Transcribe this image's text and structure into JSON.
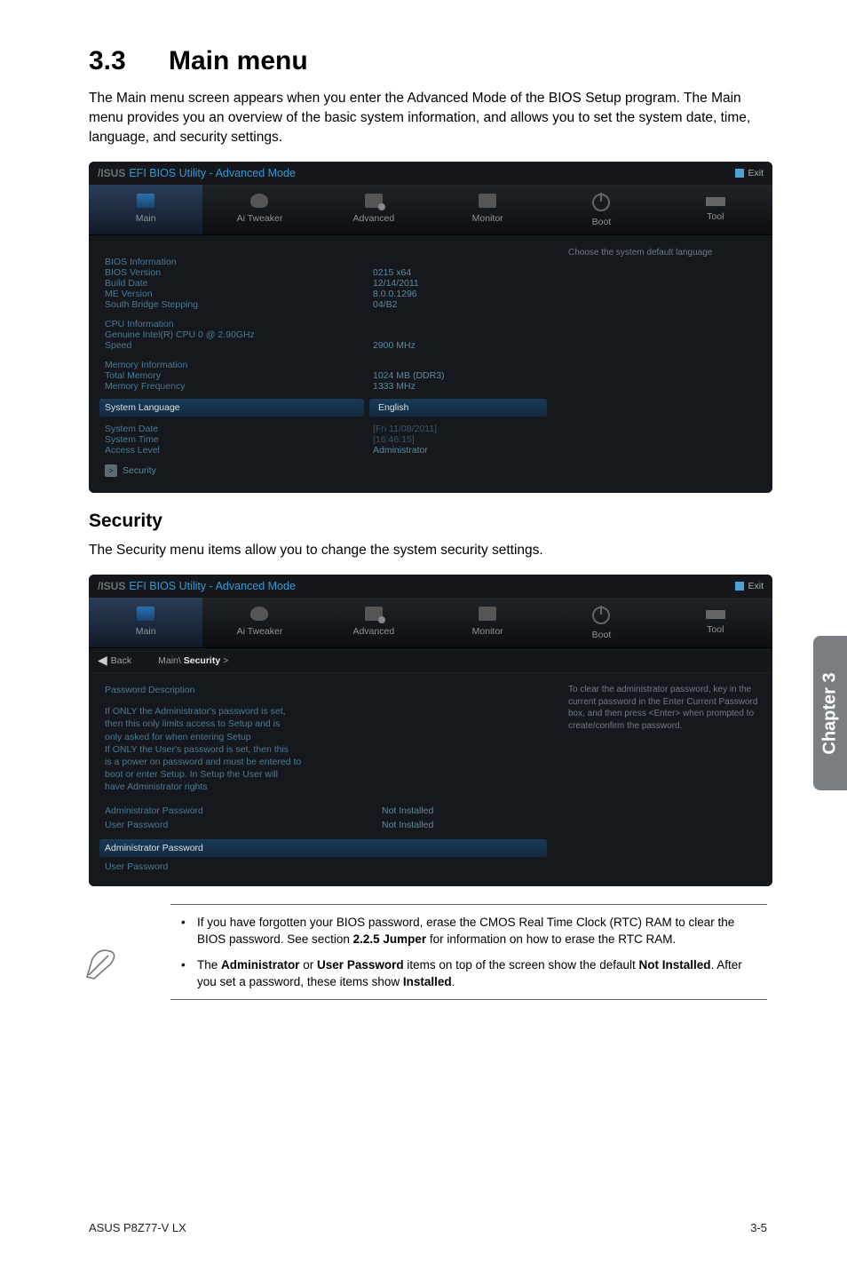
{
  "section_number": "3.3",
  "section_title": "Main menu",
  "intro": "The Main menu screen appears when you enter the Advanced Mode of the BIOS Setup program. The Main menu provides you an overview of the basic system information, and allows you to set the system date, time, language, and security settings.",
  "bios_logo": "/ISUS",
  "bios_title": "EFI BIOS Utility - Advanced Mode",
  "bios_exit": "Exit",
  "tabs": {
    "main": "Main",
    "tweaker": "Ai  Tweaker",
    "advanced": "Advanced",
    "monitor": "Monitor",
    "boot": "Boot",
    "tool": "Tool"
  },
  "right_help_1": "Choose the system default language",
  "bios_info": {
    "heading": "BIOS Information",
    "version_label": "BIOS Version",
    "version_val": "0215 x64",
    "build_label": "Build Date",
    "build_val": "12/14/2011",
    "me_label": "ME Version",
    "me_val": "8.0.0.1296",
    "sb_label": "South Bridge Stepping",
    "sb_val": "04/B2"
  },
  "cpu_info": {
    "heading": "CPU Information",
    "model": "Genuine Intel(R) CPU 0 @ 2.90GHz",
    "speed_label": "Speed",
    "speed_val": "2900 MHz"
  },
  "mem_info": {
    "heading": "Memory Information",
    "total_label": "Total Memory",
    "total_val": "1024 MB (DDR3)",
    "freq_label": "Memory Frequency",
    "freq_val": "1333 MHz"
  },
  "sys": {
    "lang_label": "System Language",
    "lang_val": "English",
    "date_label": "System Date",
    "date_val": "[Fri 11/08/2011]",
    "time_label": "System Time",
    "time_val": "[16:46:15]",
    "access_label": "Access Level",
    "access_val": "Administrator",
    "security": "Security"
  },
  "security_heading": "Security",
  "security_intro": "The Security menu items allow you to change the system security settings.",
  "crumb": {
    "back": "Back",
    "main": "Main\\",
    "security": "Security",
    "gt": ">"
  },
  "pw_desc_heading": "Password Description",
  "pw_desc_lines": [
    "If ONLY the Administrator's password is set,",
    "then this only limits access to Setup and is",
    "only asked for when entering Setup",
    "If ONLY the User's password is set, then this",
    "is a power on password and must be entered to",
    "boot or enter Setup. In Setup the User will",
    "have Administrator rights"
  ],
  "pw_rows": {
    "adm_label": "Administrator Password",
    "adm_val": "Not Installed",
    "usr_label": "User Password",
    "usr_val": "Not Installed",
    "adm_field": "Administrator Password",
    "usr_field": "User Password"
  },
  "right_help_2": "To clear the administrator password, key in the current password in the Enter Current Password box, and then press <Enter> when prompted to create/confirm the password.",
  "notes": {
    "n1_pre": "If you have forgotten your BIOS password, erase the CMOS Real Time Clock (RTC) RAM to clear the BIOS password. See section ",
    "n1_bold": "2.2.5 Jumper",
    "n1_post": " for information on how to erase the RTC RAM.",
    "n2_pre": "The ",
    "n2_b1": "Administrator",
    "n2_mid1": " or ",
    "n2_b2": "User Password",
    "n2_mid2": " items on top of the screen show the default ",
    "n2_b3": "Not Installed",
    "n2_mid3": ". After you set a password, these items show ",
    "n2_b4": "Installed",
    "n2_post": "."
  },
  "side_tab": "Chapter 3",
  "footer_left": "ASUS P8Z77-V LX",
  "footer_right": "3-5"
}
